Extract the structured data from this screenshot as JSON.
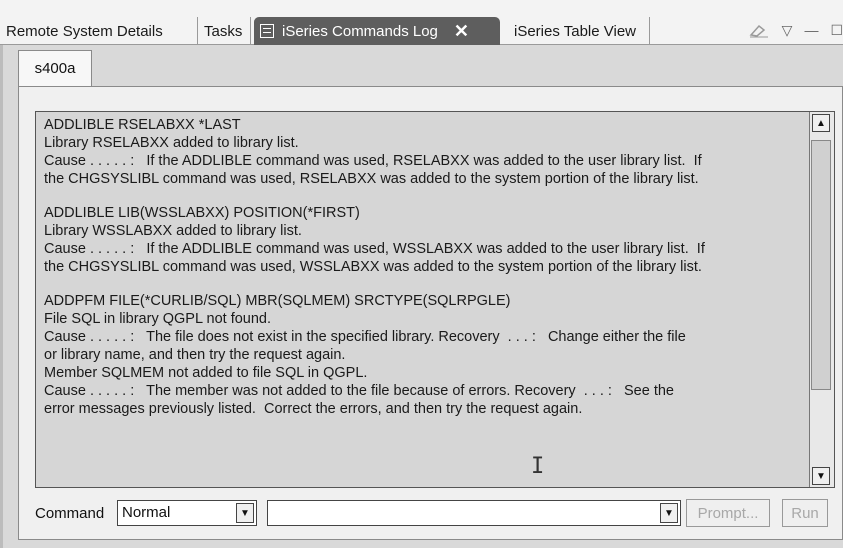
{
  "tabs": [
    {
      "label": "Remote System Details"
    },
    {
      "label": "Tasks"
    },
    {
      "label": "iSeries Commands Log",
      "active": true,
      "close": "✕"
    },
    {
      "label": "iSeries Table View"
    }
  ],
  "view_controls": {
    "eraser_icon": "eraser-icon",
    "menu_glyph": "▽",
    "minimize_glyph": "—",
    "maximize_glyph": "☐"
  },
  "subtab": {
    "label": "s400a"
  },
  "log_lines": [
    "ADDLIBLE RSELABXX *LAST",
    "Library RSELABXX added to library list.",
    "Cause . . . . . :   If the ADDLIBLE command was used, RSELABXX was added to the user library list.  If",
    "the CHGSYSLIBL command was used, RSELABXX was added to the system portion of the library list.",
    "",
    "ADDLIBLE LIB(WSSLABXX) POSITION(*FIRST)",
    "Library WSSLABXX added to library list.",
    "Cause . . . . . :   If the ADDLIBLE command was used, WSSLABXX was added to the user library list.  If",
    "the CHGSYSLIBL command was used, WSSLABXX was added to the system portion of the library list.",
    "",
    "ADDPFM FILE(*CURLIB/SQL) MBR(SQLMEM) SRCTYPE(SQLRPGLE)",
    "File SQL in library QGPL not found.",
    "Cause . . . . . :   The file does not exist in the specified library. Recovery  . . . :   Change either the file",
    "or library name, and then try the request again.",
    "Member SQLMEM not added to file SQL in QGPL.",
    "Cause . . . . . :   The member was not added to the file because of errors. Recovery  . . . :   See the",
    "error messages previously listed.  Correct the errors, and then try the request again."
  ],
  "command_bar": {
    "label": "Command",
    "mode_value": "Normal",
    "command_value": "",
    "prompt_label": "Prompt...",
    "run_label": "Run"
  }
}
